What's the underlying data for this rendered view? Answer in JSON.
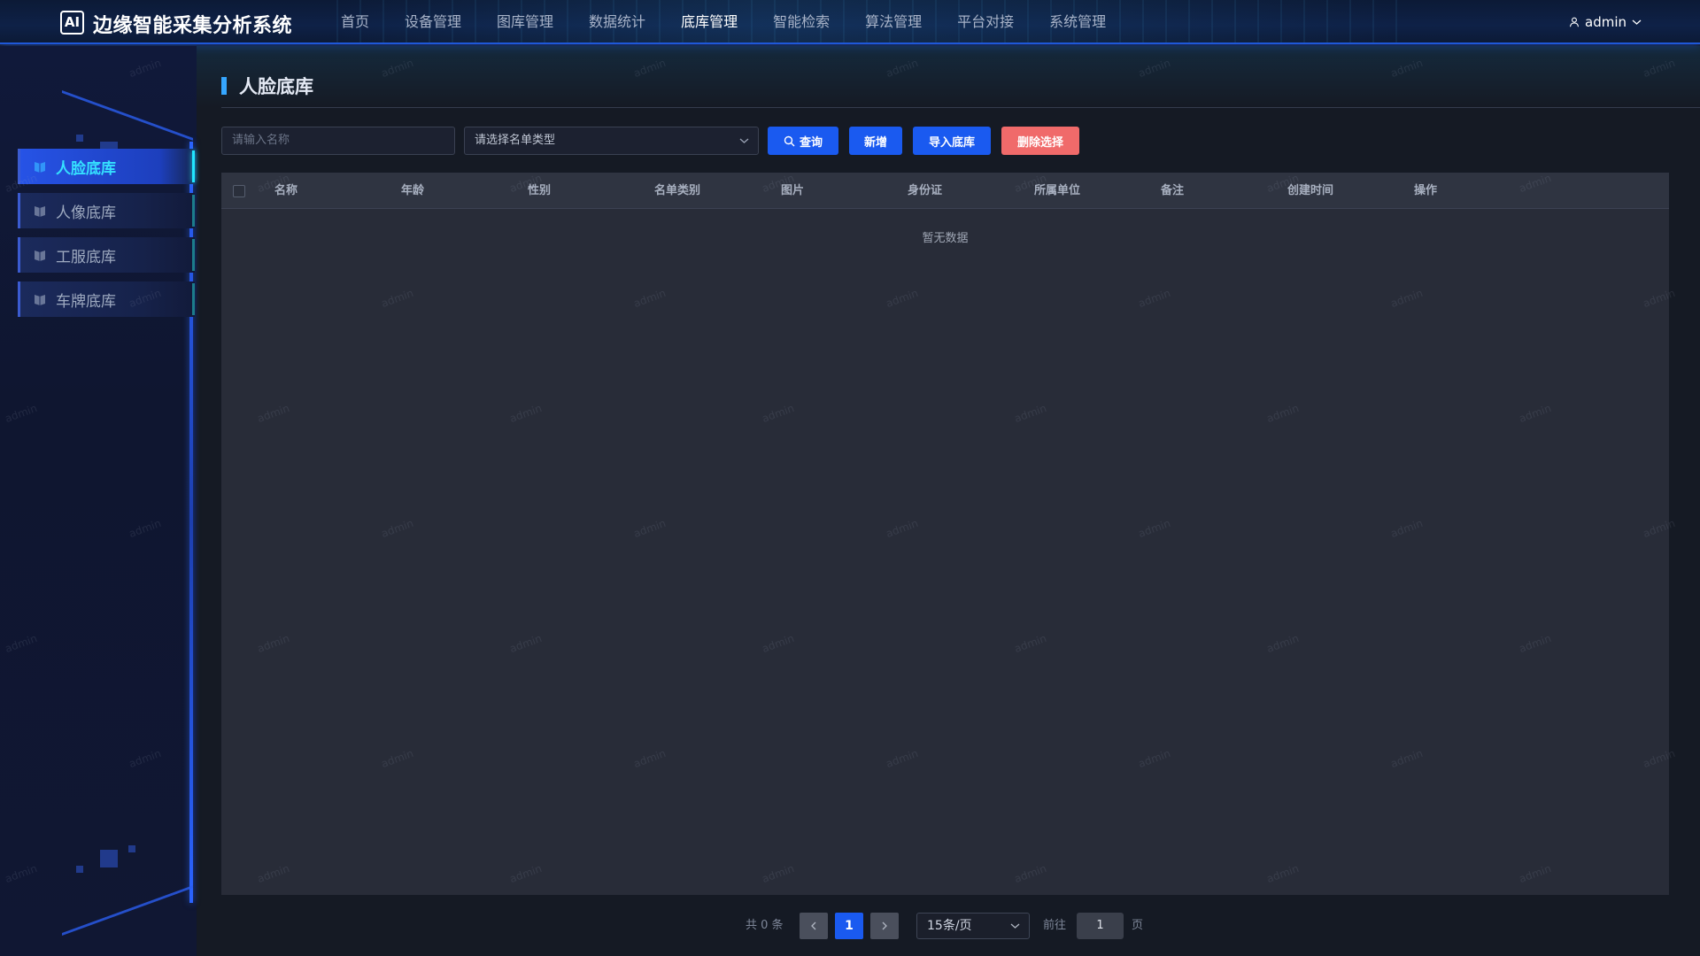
{
  "app": {
    "logo_text": "AI",
    "title": "边缘智能采集分析系统"
  },
  "nav": [
    {
      "label": "首页"
    },
    {
      "label": "设备管理"
    },
    {
      "label": "图库管理"
    },
    {
      "label": "数据统计"
    },
    {
      "label": "底库管理",
      "active": true
    },
    {
      "label": "智能检索"
    },
    {
      "label": "算法管理"
    },
    {
      "label": "平台对接"
    },
    {
      "label": "系统管理"
    }
  ],
  "user": {
    "name": "admin",
    "icon": "user-icon"
  },
  "sidebar": {
    "items": [
      {
        "label": "人脸底库",
        "active": true,
        "icon": "library-icon"
      },
      {
        "label": "人像底库",
        "icon": "library-icon"
      },
      {
        "label": "工服底库",
        "icon": "library-icon"
      },
      {
        "label": "车牌底库",
        "icon": "library-icon"
      }
    ]
  },
  "page": {
    "title": "人脸底库"
  },
  "filters": {
    "name_placeholder": "请输入名称",
    "type_placeholder": "请选择名单类型"
  },
  "toolbar": {
    "query_label": "查询",
    "add_label": "新增",
    "import_label": "导入底库",
    "delete_label": "删除选择"
  },
  "table": {
    "columns": [
      "名称",
      "年龄",
      "性别",
      "名单类别",
      "图片",
      "身份证",
      "所属单位",
      "备注",
      "创建时间",
      "操作"
    ],
    "empty_text": "暂无数据"
  },
  "pagination": {
    "total_text": "共 0 条",
    "current_page": "1",
    "page_size": "15条/页",
    "goto_label": "前往",
    "goto_value": "1",
    "page_suffix": "页"
  },
  "watermark": "admin",
  "colors": {
    "primary": "#1a5af0",
    "danger": "#f06a6a",
    "active_text": "#35e0ff",
    "header_bg": "#0e2147"
  }
}
